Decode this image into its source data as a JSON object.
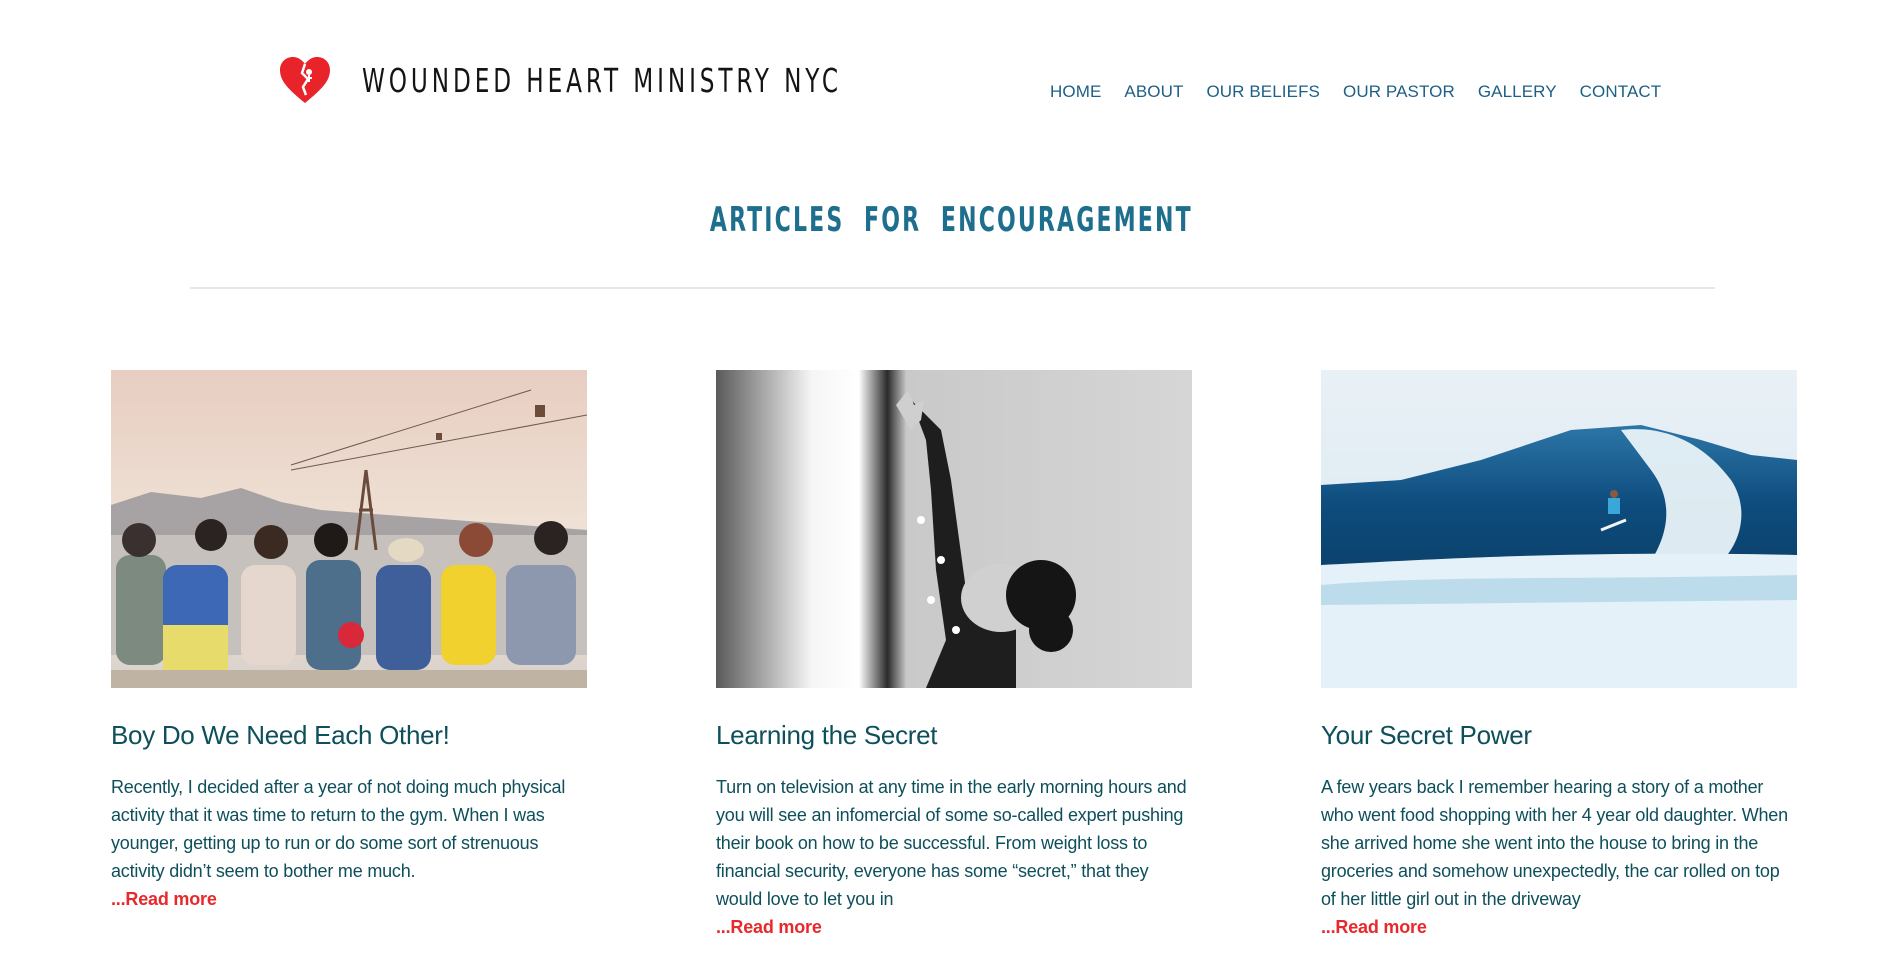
{
  "header": {
    "site_title": "WOUNDED HEART MINISTRY NYC",
    "logo_icon": "broken-heart-icon"
  },
  "nav": {
    "items": [
      "HOME",
      "ABOUT",
      "OUR BELIEFS",
      "OUR PASTOR",
      "GALLERY",
      "CONTACT"
    ]
  },
  "section": {
    "title": "ARTICLES  FOR  ENCOURAGEMENT"
  },
  "articles": [
    {
      "title": "Boy Do We Need Each Other!",
      "excerpt": "Recently, I decided after a year of not doing much physical activity that it was time to return to the gym. When I was younger, getting up to run or do some sort of strenuous activity didn’t seem to bother me much.",
      "read_more": "...Read more"
    },
    {
      "title": "Learning the Secret",
      "excerpt": "Turn on television at any time in the early morning hours and you will see an infomercial of some so-called expert pushing their book on how to be successful. From weight loss to financial security, everyone has some “secret,” that they would love to let you in",
      "read_more": "...Read more"
    },
    {
      "title": "Your Secret Power",
      "excerpt": "A few years back I remember hearing a story of a mother who went food shopping with her 4 year old daughter. When she arrived home she went into the house to bring in the groceries and somehow unexpectedly, the car rolled on top of her little girl out in the driveway",
      "read_more": "...Read more"
    }
  ],
  "colors": {
    "nav": "#1d5f86",
    "heading": "#1e6f8e",
    "card_text": "#0d4f5a",
    "read_more": "#e8292b",
    "logo": "#e8232a"
  }
}
